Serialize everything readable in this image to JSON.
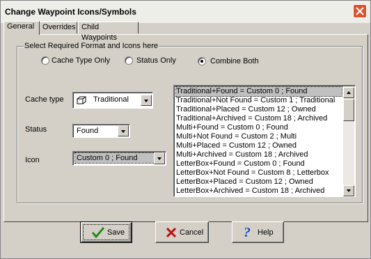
{
  "window": {
    "title": "Change Waypoint Icons/Symbols"
  },
  "tabs": [
    {
      "label": "General",
      "active": true
    },
    {
      "label": "Overrides",
      "active": false
    },
    {
      "label": "Child Waypoints",
      "active": false
    }
  ],
  "group": {
    "legend": "Select Required Format and Icons here",
    "radios": [
      {
        "label": "Cache Type Only",
        "checked": false
      },
      {
        "label": "Status Only",
        "checked": false
      },
      {
        "label": "Combine Both",
        "checked": true
      }
    ]
  },
  "fields": {
    "cache_type": {
      "label": "Cache type",
      "value": "Traditional",
      "icon": "traditional-cache-icon"
    },
    "status": {
      "label": "Status",
      "value": "Found"
    },
    "icon": {
      "label": "Icon",
      "value": "Custom 0 ; Found"
    }
  },
  "list": {
    "items": [
      "Traditional+Found = Custom 0 ; Found",
      "Traditional+Not Found = Custom 1 ; Traditional",
      "Traditional+Placed = Custom 12 ; Owned",
      "Traditional+Archived = Custom 18 ; Archived",
      "Multi+Found = Custom 0 ; Found",
      "Multi+Not Found = Custom 2 ; Multi",
      "Multi+Placed = Custom 12 ; Owned",
      "Multi+Archived = Custom 18 ; Archived",
      "LetterBox+Found = Custom 0 ; Found",
      "LetterBox+Not Found = Custom 8 ; Letterbox",
      "LetterBox+Placed = Custom 12 ; Owned",
      "LetterBox+Archived = Custom 18 ; Archived"
    ],
    "selected_index": 0
  },
  "buttons": {
    "save": {
      "label": "Save",
      "icon": "checkmark-icon",
      "accent": "#1e8c1e"
    },
    "cancel": {
      "label": "Cancel",
      "icon": "x-icon",
      "accent": "#c01010"
    },
    "help": {
      "label": "Help",
      "icon": "question-icon",
      "accent": "#1a4fc0"
    }
  }
}
